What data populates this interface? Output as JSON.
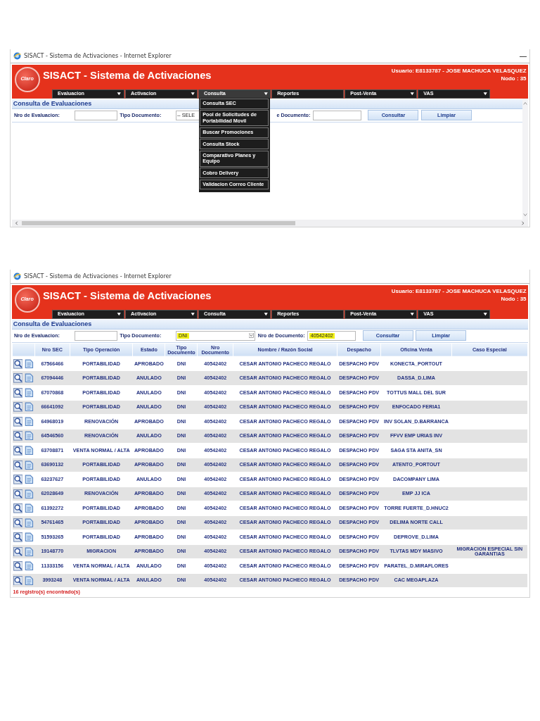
{
  "screenshots": [
    {
      "window": {
        "title": "SISACT - Sistema de Activaciones - Internet Explorer",
        "minimize_button": true
      },
      "app": {
        "logo": "Claro",
        "title": "SISACT - Sistema de Activaciones",
        "user": "Usuario: E8133787 - JOSE MACHUCA VELASQUEZ",
        "node": "Nodo : 35"
      },
      "menu": [
        {
          "label": "Evaluacion",
          "has_submenu": true,
          "expanded": false
        },
        {
          "label": "Activacion",
          "has_submenu": true,
          "expanded": false
        },
        {
          "label": "Consulta",
          "has_submenu": true,
          "expanded": true,
          "items": [
            "Consulta SEC",
            "Pool de Solicitudes de Portabilidad Movil",
            "Buscar Promociones",
            "Consulta Stock",
            "Comparativo Planes y Equipo",
            "Cobro Delivery",
            "Validacion Correo Cliente"
          ]
        },
        {
          "label": "Reportes",
          "has_submenu": false,
          "expanded": false
        },
        {
          "label": "Post-Venta",
          "has_submenu": true,
          "expanded": false
        },
        {
          "label": "VAS",
          "has_submenu": true,
          "expanded": false
        }
      ],
      "section_title": "Consulta de Evaluaciones",
      "filters": {
        "evaluation_label": "Nro de Evaluacion:",
        "document_type_label": "Tipo Documento:",
        "document_type_value": "-- SELE",
        "document_type_highlighted": false,
        "document_number_label": "e Documento:"
      },
      "buttons": [
        "Consultar",
        "Limpiar"
      ],
      "scrollbars": true
    },
    {
      "window": {
        "title": "SISACT - Sistema de Activaciones - Internet Explorer",
        "minimize_button": false
      },
      "app": {
        "logo": "Claro",
        "title": "SISACT - Sistema de Activaciones",
        "user": "Usuario: E8133787 - JOSE MACHUCA VELASQUEZ",
        "node": "Nodo : 35"
      },
      "menu": [
        {
          "label": "Evaluacion",
          "has_submenu": true,
          "expanded": false
        },
        {
          "label": "Activacion",
          "has_submenu": true,
          "expanded": false
        },
        {
          "label": "Consulta",
          "has_submenu": true,
          "expanded": false
        },
        {
          "label": "Reportes",
          "has_submenu": false,
          "expanded": false
        },
        {
          "label": "Post-Venta",
          "has_submenu": true,
          "expanded": false
        },
        {
          "label": "VAS",
          "has_submenu": true,
          "expanded": false
        }
      ],
      "section_title": "Consulta de Evaluaciones",
      "filters": {
        "evaluation_label": "Nro de Evaluacion:",
        "document_type_label": "Tipo Documento:",
        "document_type_value": "DNI",
        "document_type_highlighted": true,
        "document_type_arrow": true,
        "document_number_label": "Nro de Documento:",
        "document_number_value": "40542402",
        "document_number_highlighted": true
      },
      "buttons": [
        "Consultar",
        "Limpiar"
      ],
      "scrollbars": false,
      "table": {
        "columns": [
          "Nro SEC",
          "Tipo Operación",
          "Estado",
          "Tipo Documento",
          "Nro Documento",
          "Nombre / Razón Social",
          "Despacho",
          "Oficina Venta",
          "Caso Especial"
        ],
        "rows": [
          {
            "nro_sec": "67566466",
            "operation": "PORTABILIDAD",
            "status": "APROBADO",
            "doc_type": "DNI",
            "doc_number": "40542402",
            "name": "CESAR ANTONIO PACHECO REGALO",
            "dispatch": "DESPACHO PDV",
            "sales_office": "KONECTA_PORTOUT"
          },
          {
            "nro_sec": "67094446",
            "operation": "PORTABILIDAD",
            "status": "ANULADO",
            "doc_type": "DNI",
            "doc_number": "40542402",
            "name": "CESAR ANTONIO PACHECO REGALO",
            "dispatch": "DESPACHO PDV",
            "sales_office": "DASSA_D.LIMA"
          },
          {
            "nro_sec": "67070868",
            "operation": "PORTABILIDAD",
            "status": "ANULADO",
            "doc_type": "DNI",
            "doc_number": "40542402",
            "name": "CESAR ANTONIO PACHECO REGALO",
            "dispatch": "DESPACHO PDV",
            "sales_office": "TOTTUS MALL DEL SUR"
          },
          {
            "nro_sec": "66641092",
            "operation": "PORTABILIDAD",
            "status": "ANULADO",
            "doc_type": "DNI",
            "doc_number": "40542402",
            "name": "CESAR ANTONIO PACHECO REGALO",
            "dispatch": "DESPACHO PDV",
            "sales_office": "ENFOCADO FERIA1"
          },
          {
            "nro_sec": "64968019",
            "operation": "RENOVACIÓN",
            "status": "APROBADO",
            "doc_type": "DNI",
            "doc_number": "40542402",
            "name": "CESAR ANTONIO PACHECO REGALO",
            "dispatch": "DESPACHO PDV",
            "sales_office": "INV SOLAN_D.BARRANCA"
          },
          {
            "nro_sec": "64546560",
            "operation": "RENOVACIÓN",
            "status": "ANULADO",
            "doc_type": "DNI",
            "doc_number": "40542402",
            "name": "CESAR ANTONIO PACHECO REGALO",
            "dispatch": "DESPACHO PDV",
            "sales_office": "FFVV EMP URIAS INV"
          },
          {
            "nro_sec": "63708871",
            "operation": "VENTA NORMAL / ALTA",
            "status": "APROBADO",
            "doc_type": "DNI",
            "doc_number": "40542402",
            "name": "CESAR ANTONIO PACHECO REGALO",
            "dispatch": "DESPACHO PDV",
            "sales_office": "SAGA STA ANITA_SN"
          },
          {
            "nro_sec": "63690132",
            "operation": "PORTABILIDAD",
            "status": "APROBADO",
            "doc_type": "DNI",
            "doc_number": "40542402",
            "name": "CESAR ANTONIO PACHECO REGALO",
            "dispatch": "DESPACHO PDV",
            "sales_office": "ATENTO_PORTOUT"
          },
          {
            "nro_sec": "63237627",
            "operation": "PORTABILIDAD",
            "status": "ANULADO",
            "doc_type": "DNI",
            "doc_number": "40542402",
            "name": "CESAR ANTONIO PACHECO REGALO",
            "dispatch": "DESPACHO PDV",
            "sales_office": "DACOMPANY LIMA"
          },
          {
            "nro_sec": "62028649",
            "operation": "RENOVACIÓN",
            "status": "APROBADO",
            "doc_type": "DNI",
            "doc_number": "40542402",
            "name": "CESAR ANTONIO PACHECO REGALO",
            "dispatch": "DESPACHO PDV",
            "sales_office": "EMP JJ ICA"
          },
          {
            "nro_sec": "61392272",
            "operation": "PORTABILIDAD",
            "status": "APROBADO",
            "doc_type": "DNI",
            "doc_number": "40542402",
            "name": "CESAR ANTONIO PACHECO REGALO",
            "dispatch": "DESPACHO PDV",
            "sales_office": "TORRE FUERTE_D.HNUC2"
          },
          {
            "nro_sec": "54761465",
            "operation": "PORTABILIDAD",
            "status": "APROBADO",
            "doc_type": "DNI",
            "doc_number": "40542402",
            "name": "CESAR ANTONIO PACHECO REGALO",
            "dispatch": "DESPACHO PDV",
            "sales_office": "DELIMA NORTE CALL"
          },
          {
            "nro_sec": "51593265",
            "operation": "PORTABILIDAD",
            "status": "APROBADO",
            "doc_type": "DNI",
            "doc_number": "40542402",
            "name": "CESAR ANTONIO PACHECO REGALO",
            "dispatch": "DESPACHO PDV",
            "sales_office": "DEPROVE_D.LIMA"
          },
          {
            "nro_sec": "19148770",
            "operation": "MIGRACION",
            "status": "APROBADO",
            "doc_type": "DNI",
            "doc_number": "40542402",
            "name": "CESAR ANTONIO PACHECO REGALO",
            "dispatch": "DESPACHO PDV",
            "sales_office": "TLVTAS MDY MASIVO",
            "special_case": "MIGRACION ESPECIAL SIN GARANTIAS"
          },
          {
            "nro_sec": "11333156",
            "operation": "VENTA NORMAL / ALTA",
            "status": "ANULADO",
            "doc_type": "DNI",
            "doc_number": "40542402",
            "name": "CESAR ANTONIO PACHECO REGALO",
            "dispatch": "DESPACHO PDV",
            "sales_office": "PARATEL_D.MIRAFLORES"
          },
          {
            "nro_sec": "3993248",
            "operation": "VENTA NORMAL / ALTA",
            "status": "ANULADO",
            "doc_type": "DNI",
            "doc_number": "40542402",
            "name": "CESAR ANTONIO PACHECO REGALO",
            "dispatch": "DESPACHO PDV",
            "sales_office": "CAC MEGAPLAZA"
          }
        ]
      },
      "result_count": "16 registro(s) encontrado(s)"
    }
  ]
}
